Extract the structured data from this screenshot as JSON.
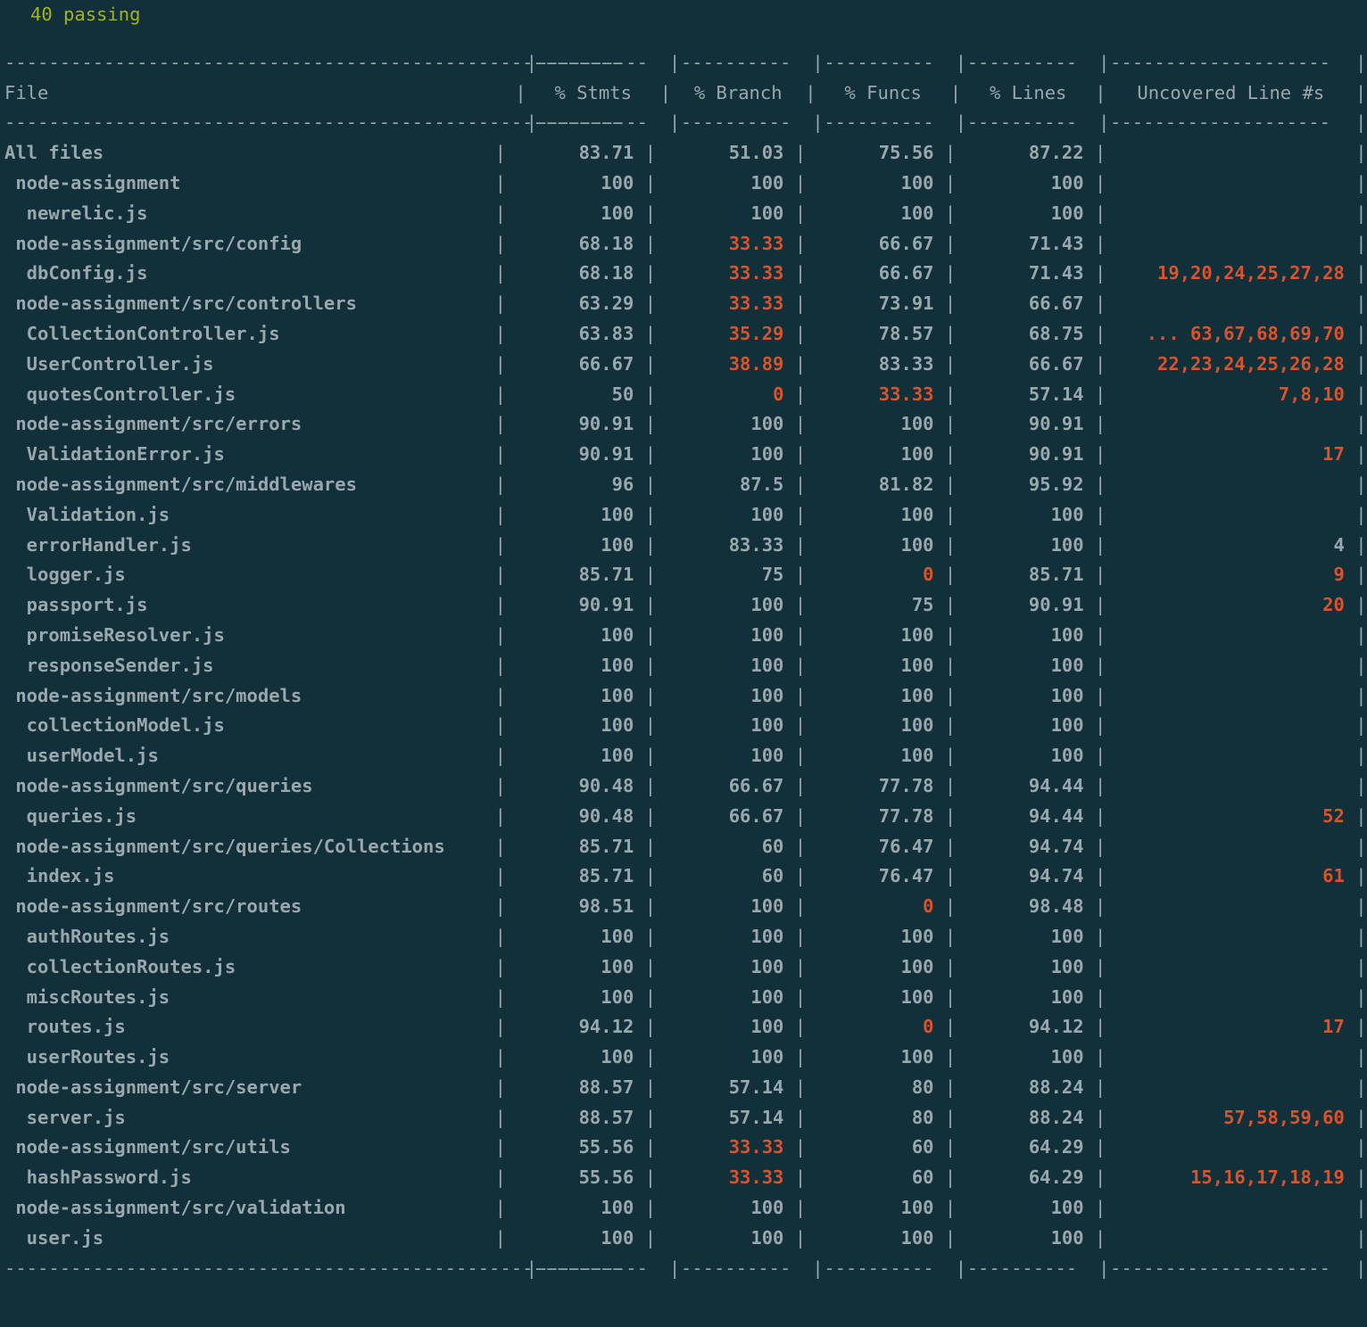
{
  "terminal": {
    "background_color": "#11303a",
    "default_text_color": "#9aa8ad",
    "low_coverage_color": "#d9532c",
    "pass_color": "#a3b41f"
  },
  "test_summary": {
    "passing": "40 passing"
  },
  "table": {
    "rule_file": "--------------------------------------------------------",
    "rule_num": "----------",
    "rule_unc": "--------------------",
    "bar": "|",
    "columns": [
      {
        "key": "file",
        "label": "File"
      },
      {
        "key": "stmts",
        "label": "% Stmts"
      },
      {
        "key": "branch",
        "label": "% Branch"
      },
      {
        "key": "funcs",
        "label": "% Funcs"
      },
      {
        "key": "lines",
        "label": "% Lines"
      },
      {
        "key": "uncovered",
        "label": "Uncovered Line #s"
      }
    ],
    "rows": [
      {
        "indent": 0,
        "file": "All files",
        "stmts": "83.71",
        "branch": "51.03",
        "funcs": "75.56",
        "lines": "87.22",
        "uncovered": "",
        "low": {
          "stmts": false,
          "branch": false,
          "funcs": false,
          "lines": false,
          "uncovered": false
        }
      },
      {
        "indent": 1,
        "file": "node-assignment",
        "stmts": "100",
        "branch": "100",
        "funcs": "100",
        "lines": "100",
        "uncovered": "",
        "low": {
          "stmts": false,
          "branch": false,
          "funcs": false,
          "lines": false,
          "uncovered": false
        }
      },
      {
        "indent": 2,
        "file": "newrelic.js",
        "stmts": "100",
        "branch": "100",
        "funcs": "100",
        "lines": "100",
        "uncovered": "",
        "low": {
          "stmts": false,
          "branch": false,
          "funcs": false,
          "lines": false,
          "uncovered": false
        }
      },
      {
        "indent": 1,
        "file": "node-assignment/src/config",
        "stmts": "68.18",
        "branch": "33.33",
        "funcs": "66.67",
        "lines": "71.43",
        "uncovered": "",
        "low": {
          "stmts": false,
          "branch": true,
          "funcs": false,
          "lines": false,
          "uncovered": false
        }
      },
      {
        "indent": 2,
        "file": "dbConfig.js",
        "stmts": "68.18",
        "branch": "33.33",
        "funcs": "66.67",
        "lines": "71.43",
        "uncovered": "19,20,24,25,27,28",
        "low": {
          "stmts": false,
          "branch": true,
          "funcs": false,
          "lines": false,
          "uncovered": true
        }
      },
      {
        "indent": 1,
        "file": "node-assignment/src/controllers",
        "stmts": "63.29",
        "branch": "33.33",
        "funcs": "73.91",
        "lines": "66.67",
        "uncovered": "",
        "low": {
          "stmts": false,
          "branch": true,
          "funcs": false,
          "lines": false,
          "uncovered": false
        }
      },
      {
        "indent": 2,
        "file": "CollectionController.js",
        "stmts": "63.83",
        "branch": "35.29",
        "funcs": "78.57",
        "lines": "68.75",
        "uncovered": "... 63,67,68,69,70",
        "low": {
          "stmts": false,
          "branch": true,
          "funcs": false,
          "lines": false,
          "uncovered": true
        }
      },
      {
        "indent": 2,
        "file": "UserController.js",
        "stmts": "66.67",
        "branch": "38.89",
        "funcs": "83.33",
        "lines": "66.67",
        "uncovered": "22,23,24,25,26,28",
        "low": {
          "stmts": false,
          "branch": true,
          "funcs": false,
          "lines": false,
          "uncovered": true
        }
      },
      {
        "indent": 2,
        "file": "quotesController.js",
        "stmts": "50",
        "branch": "0",
        "funcs": "33.33",
        "lines": "57.14",
        "uncovered": "7,8,10",
        "low": {
          "stmts": false,
          "branch": true,
          "funcs": true,
          "lines": false,
          "uncovered": true
        }
      },
      {
        "indent": 1,
        "file": "node-assignment/src/errors",
        "stmts": "90.91",
        "branch": "100",
        "funcs": "100",
        "lines": "90.91",
        "uncovered": "",
        "low": {
          "stmts": false,
          "branch": false,
          "funcs": false,
          "lines": false,
          "uncovered": false
        }
      },
      {
        "indent": 2,
        "file": "ValidationError.js",
        "stmts": "90.91",
        "branch": "100",
        "funcs": "100",
        "lines": "90.91",
        "uncovered": "17",
        "low": {
          "stmts": false,
          "branch": false,
          "funcs": false,
          "lines": false,
          "uncovered": true
        }
      },
      {
        "indent": 1,
        "file": "node-assignment/src/middlewares",
        "stmts": "96",
        "branch": "87.5",
        "funcs": "81.82",
        "lines": "95.92",
        "uncovered": "",
        "low": {
          "stmts": false,
          "branch": false,
          "funcs": false,
          "lines": false,
          "uncovered": false
        }
      },
      {
        "indent": 2,
        "file": "Validation.js",
        "stmts": "100",
        "branch": "100",
        "funcs": "100",
        "lines": "100",
        "uncovered": "",
        "low": {
          "stmts": false,
          "branch": false,
          "funcs": false,
          "lines": false,
          "uncovered": false
        }
      },
      {
        "indent": 2,
        "file": "errorHandler.js",
        "stmts": "100",
        "branch": "83.33",
        "funcs": "100",
        "lines": "100",
        "uncovered": "4",
        "low": {
          "stmts": false,
          "branch": false,
          "funcs": false,
          "lines": false,
          "uncovered": false
        }
      },
      {
        "indent": 2,
        "file": "logger.js",
        "stmts": "85.71",
        "branch": "75",
        "funcs": "0",
        "lines": "85.71",
        "uncovered": "9",
        "low": {
          "stmts": false,
          "branch": false,
          "funcs": true,
          "lines": false,
          "uncovered": true
        }
      },
      {
        "indent": 2,
        "file": "passport.js",
        "stmts": "90.91",
        "branch": "100",
        "funcs": "75",
        "lines": "90.91",
        "uncovered": "20",
        "low": {
          "stmts": false,
          "branch": false,
          "funcs": false,
          "lines": false,
          "uncovered": true
        }
      },
      {
        "indent": 2,
        "file": "promiseResolver.js",
        "stmts": "100",
        "branch": "100",
        "funcs": "100",
        "lines": "100",
        "uncovered": "",
        "low": {
          "stmts": false,
          "branch": false,
          "funcs": false,
          "lines": false,
          "uncovered": false
        }
      },
      {
        "indent": 2,
        "file": "responseSender.js",
        "stmts": "100",
        "branch": "100",
        "funcs": "100",
        "lines": "100",
        "uncovered": "",
        "low": {
          "stmts": false,
          "branch": false,
          "funcs": false,
          "lines": false,
          "uncovered": false
        }
      },
      {
        "indent": 1,
        "file": "node-assignment/src/models",
        "stmts": "100",
        "branch": "100",
        "funcs": "100",
        "lines": "100",
        "uncovered": "",
        "low": {
          "stmts": false,
          "branch": false,
          "funcs": false,
          "lines": false,
          "uncovered": false
        }
      },
      {
        "indent": 2,
        "file": "collectionModel.js",
        "stmts": "100",
        "branch": "100",
        "funcs": "100",
        "lines": "100",
        "uncovered": "",
        "low": {
          "stmts": false,
          "branch": false,
          "funcs": false,
          "lines": false,
          "uncovered": false
        }
      },
      {
        "indent": 2,
        "file": "userModel.js",
        "stmts": "100",
        "branch": "100",
        "funcs": "100",
        "lines": "100",
        "uncovered": "",
        "low": {
          "stmts": false,
          "branch": false,
          "funcs": false,
          "lines": false,
          "uncovered": false
        }
      },
      {
        "indent": 1,
        "file": "node-assignment/src/queries",
        "stmts": "90.48",
        "branch": "66.67",
        "funcs": "77.78",
        "lines": "94.44",
        "uncovered": "",
        "low": {
          "stmts": false,
          "branch": false,
          "funcs": false,
          "lines": false,
          "uncovered": false
        }
      },
      {
        "indent": 2,
        "file": "queries.js",
        "stmts": "90.48",
        "branch": "66.67",
        "funcs": "77.78",
        "lines": "94.44",
        "uncovered": "52",
        "low": {
          "stmts": false,
          "branch": false,
          "funcs": false,
          "lines": false,
          "uncovered": true
        }
      },
      {
        "indent": 1,
        "file": "node-assignment/src/queries/Collections",
        "stmts": "85.71",
        "branch": "60",
        "funcs": "76.47",
        "lines": "94.74",
        "uncovered": "",
        "low": {
          "stmts": false,
          "branch": false,
          "funcs": false,
          "lines": false,
          "uncovered": false
        }
      },
      {
        "indent": 2,
        "file": "index.js",
        "stmts": "85.71",
        "branch": "60",
        "funcs": "76.47",
        "lines": "94.74",
        "uncovered": "61",
        "low": {
          "stmts": false,
          "branch": false,
          "funcs": false,
          "lines": false,
          "uncovered": true
        }
      },
      {
        "indent": 1,
        "file": "node-assignment/src/routes",
        "stmts": "98.51",
        "branch": "100",
        "funcs": "0",
        "lines": "98.48",
        "uncovered": "",
        "low": {
          "stmts": false,
          "branch": false,
          "funcs": true,
          "lines": false,
          "uncovered": false
        }
      },
      {
        "indent": 2,
        "file": "authRoutes.js",
        "stmts": "100",
        "branch": "100",
        "funcs": "100",
        "lines": "100",
        "uncovered": "",
        "low": {
          "stmts": false,
          "branch": false,
          "funcs": false,
          "lines": false,
          "uncovered": false
        }
      },
      {
        "indent": 2,
        "file": "collectionRoutes.js",
        "stmts": "100",
        "branch": "100",
        "funcs": "100",
        "lines": "100",
        "uncovered": "",
        "low": {
          "stmts": false,
          "branch": false,
          "funcs": false,
          "lines": false,
          "uncovered": false
        }
      },
      {
        "indent": 2,
        "file": "miscRoutes.js",
        "stmts": "100",
        "branch": "100",
        "funcs": "100",
        "lines": "100",
        "uncovered": "",
        "low": {
          "stmts": false,
          "branch": false,
          "funcs": false,
          "lines": false,
          "uncovered": false
        }
      },
      {
        "indent": 2,
        "file": "routes.js",
        "stmts": "94.12",
        "branch": "100",
        "funcs": "0",
        "lines": "94.12",
        "uncovered": "17",
        "low": {
          "stmts": false,
          "branch": false,
          "funcs": true,
          "lines": false,
          "uncovered": true
        }
      },
      {
        "indent": 2,
        "file": "userRoutes.js",
        "stmts": "100",
        "branch": "100",
        "funcs": "100",
        "lines": "100",
        "uncovered": "",
        "low": {
          "stmts": false,
          "branch": false,
          "funcs": false,
          "lines": false,
          "uncovered": false
        }
      },
      {
        "indent": 1,
        "file": "node-assignment/src/server",
        "stmts": "88.57",
        "branch": "57.14",
        "funcs": "80",
        "lines": "88.24",
        "uncovered": "",
        "low": {
          "stmts": false,
          "branch": false,
          "funcs": false,
          "lines": false,
          "uncovered": false
        }
      },
      {
        "indent": 2,
        "file": "server.js",
        "stmts": "88.57",
        "branch": "57.14",
        "funcs": "80",
        "lines": "88.24",
        "uncovered": "57,58,59,60",
        "low": {
          "stmts": false,
          "branch": false,
          "funcs": false,
          "lines": false,
          "uncovered": true
        }
      },
      {
        "indent": 1,
        "file": "node-assignment/src/utils",
        "stmts": "55.56",
        "branch": "33.33",
        "funcs": "60",
        "lines": "64.29",
        "uncovered": "",
        "low": {
          "stmts": false,
          "branch": true,
          "funcs": false,
          "lines": false,
          "uncovered": false
        }
      },
      {
        "indent": 2,
        "file": "hashPassword.js",
        "stmts": "55.56",
        "branch": "33.33",
        "funcs": "60",
        "lines": "64.29",
        "uncovered": "15,16,17,18,19",
        "low": {
          "stmts": false,
          "branch": true,
          "funcs": false,
          "lines": false,
          "uncovered": true
        }
      },
      {
        "indent": 1,
        "file": "node-assignment/src/validation",
        "stmts": "100",
        "branch": "100",
        "funcs": "100",
        "lines": "100",
        "uncovered": "",
        "low": {
          "stmts": false,
          "branch": false,
          "funcs": false,
          "lines": false,
          "uncovered": false
        }
      },
      {
        "indent": 2,
        "file": "user.js",
        "stmts": "100",
        "branch": "100",
        "funcs": "100",
        "lines": "100",
        "uncovered": "",
        "low": {
          "stmts": false,
          "branch": false,
          "funcs": false,
          "lines": false,
          "uncovered": false
        }
      }
    ]
  }
}
